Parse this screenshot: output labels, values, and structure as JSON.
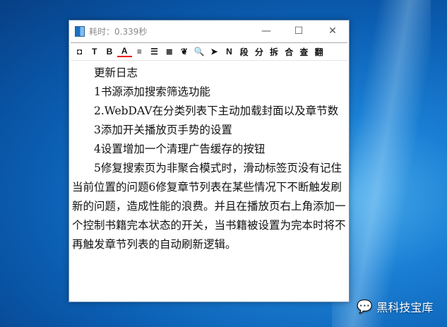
{
  "window": {
    "title": "耗时：0.339秒",
    "minimize": "—",
    "maximize": "☐",
    "close": "✕"
  },
  "toolbar": [
    {
      "name": "stop-icon",
      "label": "◘"
    },
    {
      "name": "font-icon",
      "label": "T"
    },
    {
      "name": "bold-icon",
      "label": "B"
    },
    {
      "name": "font-color-icon",
      "label": "A"
    },
    {
      "name": "align-left-icon",
      "label": "≡"
    },
    {
      "name": "justify-icon",
      "label": "☰"
    },
    {
      "name": "align-right-icon",
      "label": "≣"
    },
    {
      "name": "theme-icon",
      "label": "❦"
    },
    {
      "name": "search-icon",
      "label": "🔍"
    },
    {
      "name": "send-icon",
      "label": "➤"
    },
    {
      "name": "n-icon",
      "label": "N"
    },
    {
      "name": "paragraph-button",
      "label": "段"
    },
    {
      "name": "split-button",
      "label": "分"
    },
    {
      "name": "break-button",
      "label": "拆"
    },
    {
      "name": "merge-button",
      "label": "合"
    },
    {
      "name": "lookup-button",
      "label": "查"
    },
    {
      "name": "translate-button",
      "label": "翻"
    }
  ],
  "content": [
    "更新日志",
    "1书源添加搜索筛选功能",
    "2.WebDAV在分类列表下主动加载封面以及章节数",
    "3添加开关播放页手势的设置",
    "4设置增加一个清理广告缓存的按钮",
    "5修复搜索页为非聚合模式时，滑动标签页没有记住当前位置的问题6修复章节列表在某些情况下不断触发刷新的问题，造成性能的浪费。并且在播放页右上角添加一个控制书籍完本状态的开关，当书籍被设置为完本时将不再触发章节列表的自动刷新逻辑。"
  ],
  "watermark": "黑科技宝库"
}
